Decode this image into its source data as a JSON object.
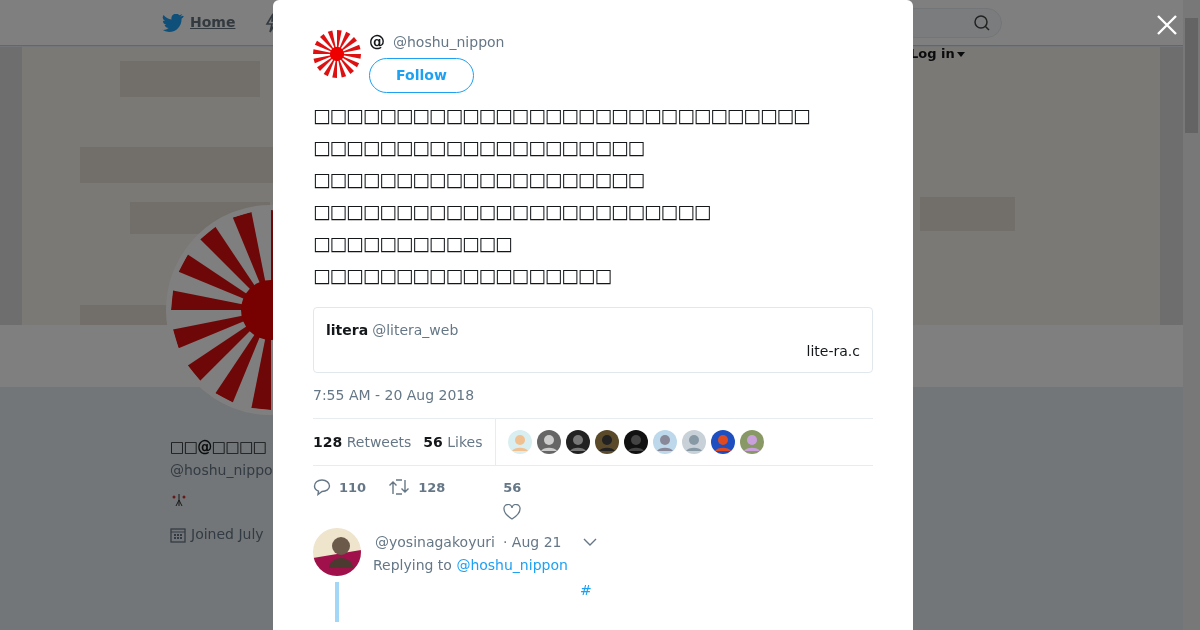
{
  "nav": {
    "home": "Home",
    "login": "Log in"
  },
  "profile": {
    "name": "□□@□□□□",
    "handle": "@hoshu_nippo",
    "joined": "Joined July"
  },
  "tweet": {
    "name": "@",
    "handle": "@hoshu_nippon",
    "follow": "Follow",
    "lines": [
      "□□□□□□□□□□□□□□□□□□□□□□□□□□□□□□",
      "□□□□□□□□□□□□□□□□□□□□",
      "□□□□□□□□□□□□□□□□□□□□",
      "□□□□□□□□□□□□□□□□□□□□□□□□",
      "□□□□□□□□□□□□",
      "□□□□□□□□□□□□□□□□□□"
    ],
    "quote": {
      "name": "litera",
      "handle": "@litera_web",
      "link": "lite-ra.c"
    },
    "timestamp": "7:55 AM - 20 Aug 2018",
    "stats": {
      "retweets": "128",
      "retweets_label": "Retweets",
      "likes": "56",
      "likes_label": "Likes"
    },
    "actions": {
      "replies": "110",
      "retweets": "128",
      "likes": "56"
    }
  },
  "reply": {
    "handle": "@yosinagakoyuri",
    "time": "· Aug 21",
    "replying_to": "Replying to",
    "mention": "@hoshu_nippon",
    "hashtag": "#"
  }
}
